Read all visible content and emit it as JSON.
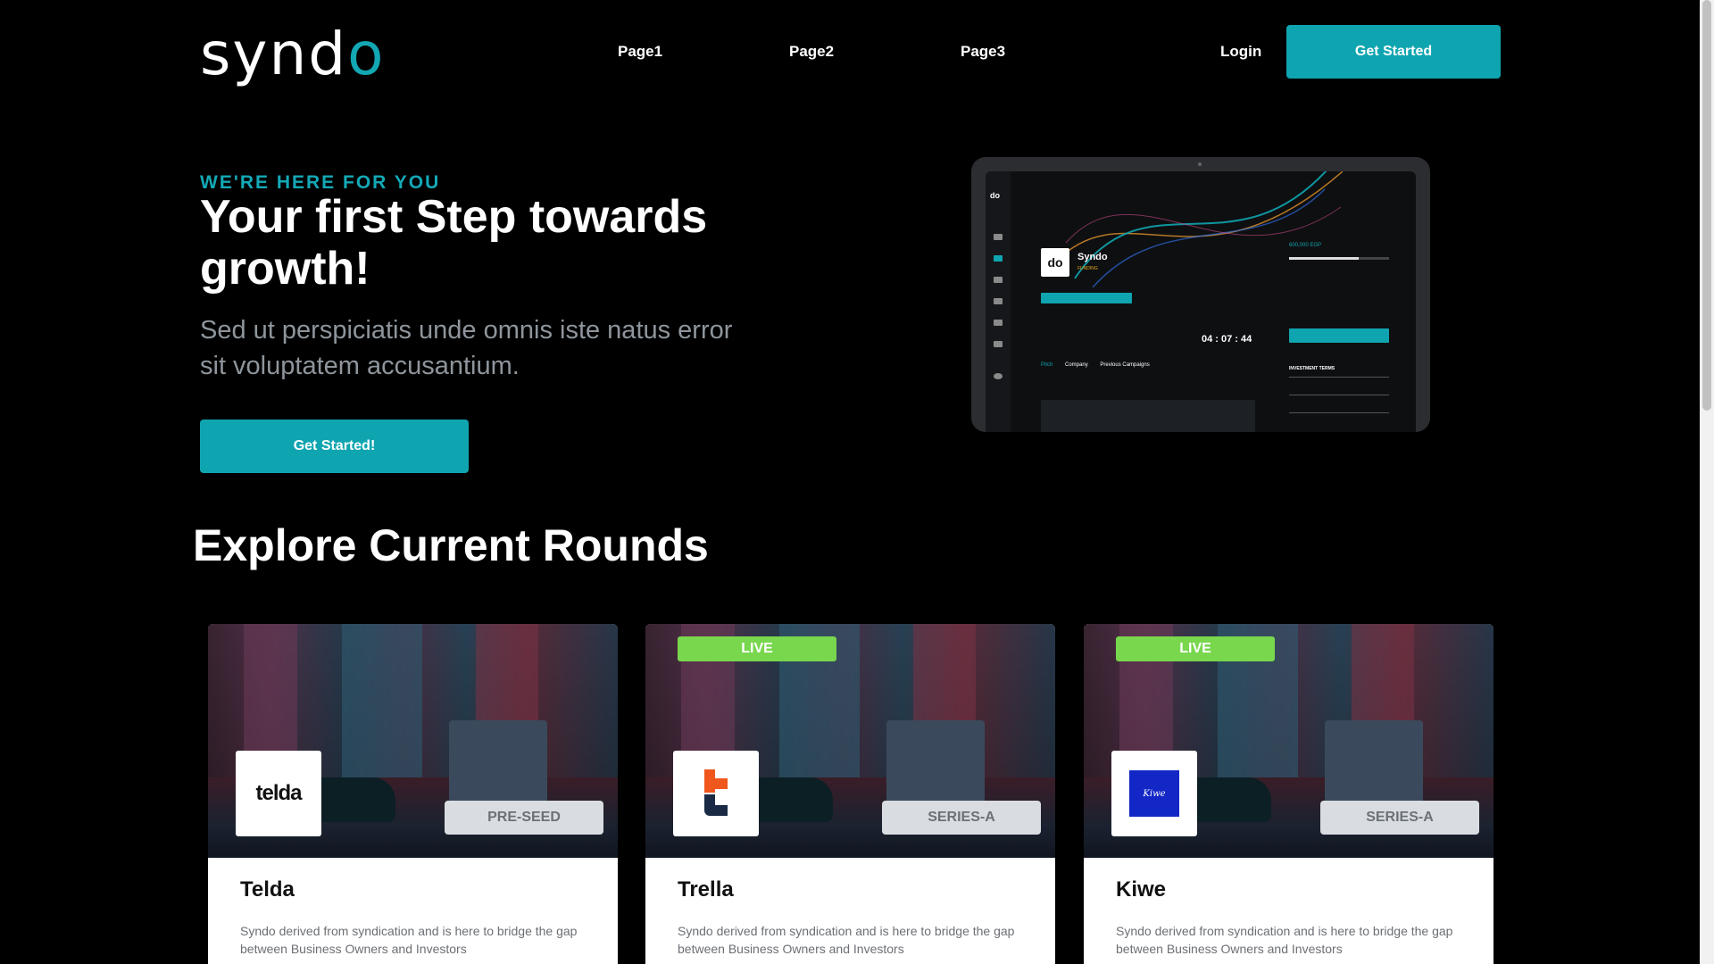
{
  "header": {
    "logo_main": "synd",
    "logo_accent": "o",
    "nav": [
      "Page1",
      "Page2",
      "Page3"
    ],
    "login_label": "Login",
    "cta_label": "Get Started"
  },
  "hero": {
    "eyebrow": "WE'RE HERE FOR YOU",
    "title": "Your first Step towards growth!",
    "subtitle": "Sed ut perspiciatis unde omnis iste natus error sit voluptatem accusantium.",
    "cta_label": "Get Started!"
  },
  "mockup": {
    "logo_text": "do",
    "company": "Syndo",
    "status": "FUNDING",
    "funding": "600,000 EGP",
    "timer": "04 : 07 : 44",
    "tabs": [
      "Pitch",
      "Company",
      "Previous Campaigns"
    ],
    "terms_title": "INVESTMENT TERMS"
  },
  "explore": {
    "title": "Explore Current Rounds",
    "cards": [
      {
        "name": "Telda",
        "stage": "PRE-SEED",
        "live": false,
        "logo": "telda",
        "logo_text": "telda",
        "desc": "Syndo derived from syndication and is here to bridge the gap between Business Owners and Investors"
      },
      {
        "name": "Trella",
        "stage": "SERIES-A",
        "live": true,
        "live_label": "LIVE",
        "logo": "trella",
        "desc": "Syndo derived from syndication and is here to bridge the gap between Business Owners and Investors"
      },
      {
        "name": "Kiwe",
        "stage": "SERIES-A",
        "live": true,
        "live_label": "LIVE",
        "logo": "kiwe",
        "logo_text": "Kiwe",
        "desc": "Syndo derived from syndication and is here to bridge the gap between Business Owners and Investors"
      }
    ]
  },
  "colors": {
    "accent": "#0fa5b0",
    "live": "#79d74e",
    "background": "#000000"
  }
}
